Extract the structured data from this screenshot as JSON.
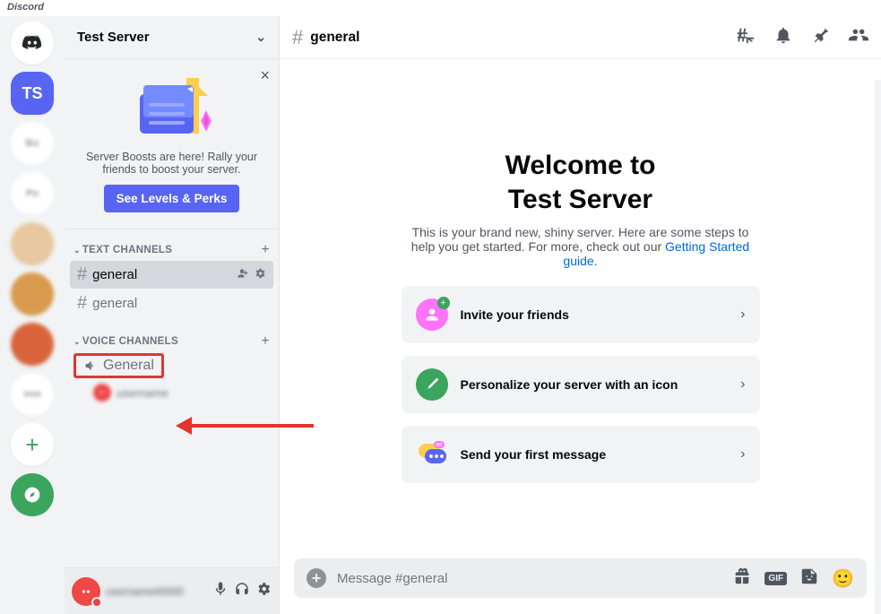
{
  "app_label": "Discord",
  "server_rail": {
    "selected_initials": "TS"
  },
  "sidebar": {
    "server_name": "Test Server",
    "promo": {
      "line": "Server Boosts are here! Rally your friends to boost your server.",
      "button": "See Levels & Perks"
    },
    "text_channels_header": "TEXT CHANNELS",
    "voice_channels_header": "VOICE CHANNELS",
    "text_channels": [
      {
        "name": "general",
        "selected": true
      },
      {
        "name": "general",
        "selected": false
      }
    ],
    "voice_channels": [
      {
        "name": "General"
      }
    ]
  },
  "channel_view": {
    "channel_name": "general",
    "welcome_title_l1": "Welcome to",
    "welcome_title_l2": "Test Server",
    "welcome_sub_pre": "This is your brand new, shiny server. Here are some steps to help you get started. For more, check out our ",
    "welcome_link": "Getting Started guide",
    "welcome_sub_post": ".",
    "cards": [
      {
        "label": "Invite your friends"
      },
      {
        "label": "Personalize your server with an icon"
      },
      {
        "label": "Send your first message"
      }
    ],
    "message_placeholder": "Message #general"
  }
}
